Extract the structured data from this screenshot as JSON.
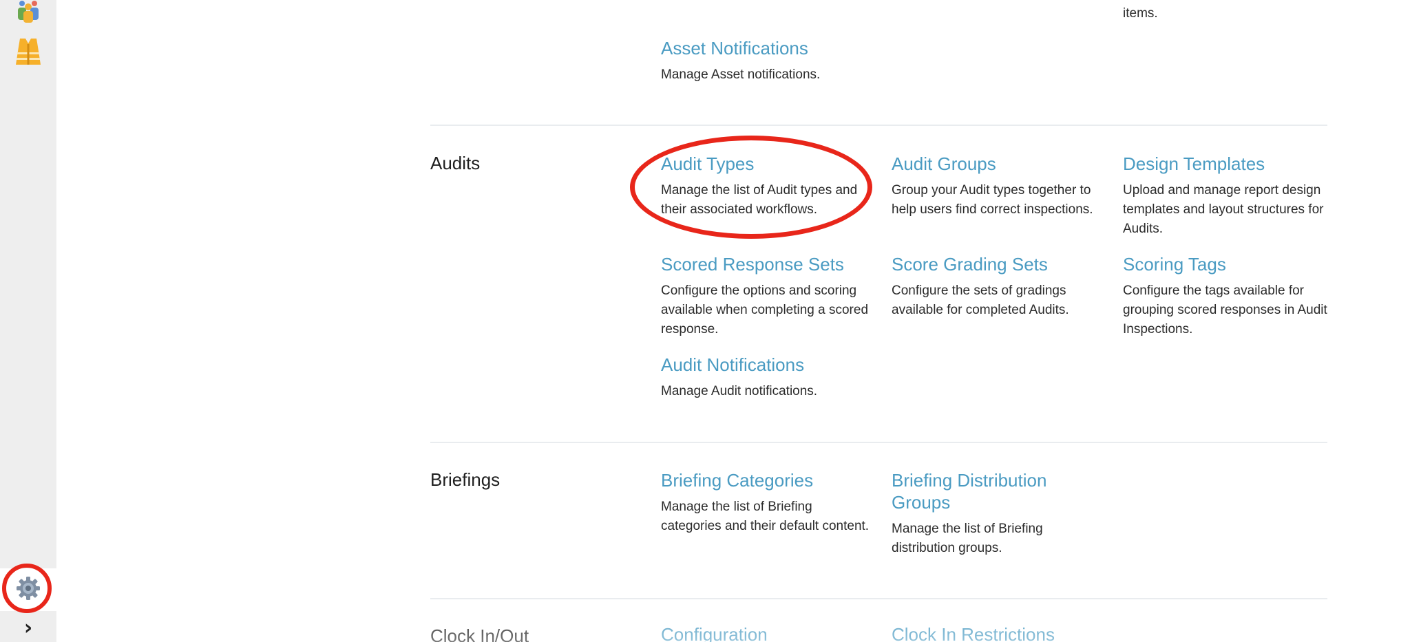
{
  "sidebar": {
    "people_icon": "people-group-icon",
    "vest_icon": "safety-vest-icon",
    "settings_icon": "gear-icon",
    "expand_icon": "chevron-right-icon",
    "expand_glyph": "›"
  },
  "sections": {
    "top": {
      "overflow_text": "items.",
      "asset_notifications": {
        "title": "Asset Notifications",
        "desc": "Manage Asset notifications."
      }
    },
    "audits": {
      "title": "Audits",
      "audit_types": {
        "title": "Audit Types",
        "desc": "Manage the list of Audit types and their associated workflows."
      },
      "audit_groups": {
        "title": "Audit Groups",
        "desc": "Group your Audit types together to help users find correct inspections."
      },
      "design_templates": {
        "title": "Design Templates",
        "desc": "Upload and manage report design templates and layout structures for Audits."
      },
      "scored_response_sets": {
        "title": "Scored Response Sets",
        "desc": "Configure the options and scoring available when completing a scored response."
      },
      "score_grading_sets": {
        "title": "Score Grading Sets",
        "desc": "Configure the sets of gradings available for completed Audits."
      },
      "scoring_tags": {
        "title": "Scoring Tags",
        "desc": "Configure the tags available for grouping scored responses in Audit Inspections."
      },
      "audit_notifications": {
        "title": "Audit Notifications",
        "desc": "Manage Audit notifications."
      }
    },
    "briefings": {
      "title": "Briefings",
      "briefing_categories": {
        "title": "Briefing Categories",
        "desc": "Manage the list of Briefing categories and their default content."
      },
      "briefing_distribution_groups": {
        "title": "Briefing Distribution Groups",
        "desc": "Manage the list of Briefing distribution groups."
      }
    },
    "clock": {
      "title": "Clock In/Out",
      "configuration": {
        "title": "Configuration"
      },
      "clock_in_restrictions": {
        "title": "Clock In Restrictions"
      }
    }
  },
  "colors": {
    "link": "#4a9bc2",
    "annotation_ring": "#e8261a",
    "rail_bg": "#eeeeee"
  }
}
